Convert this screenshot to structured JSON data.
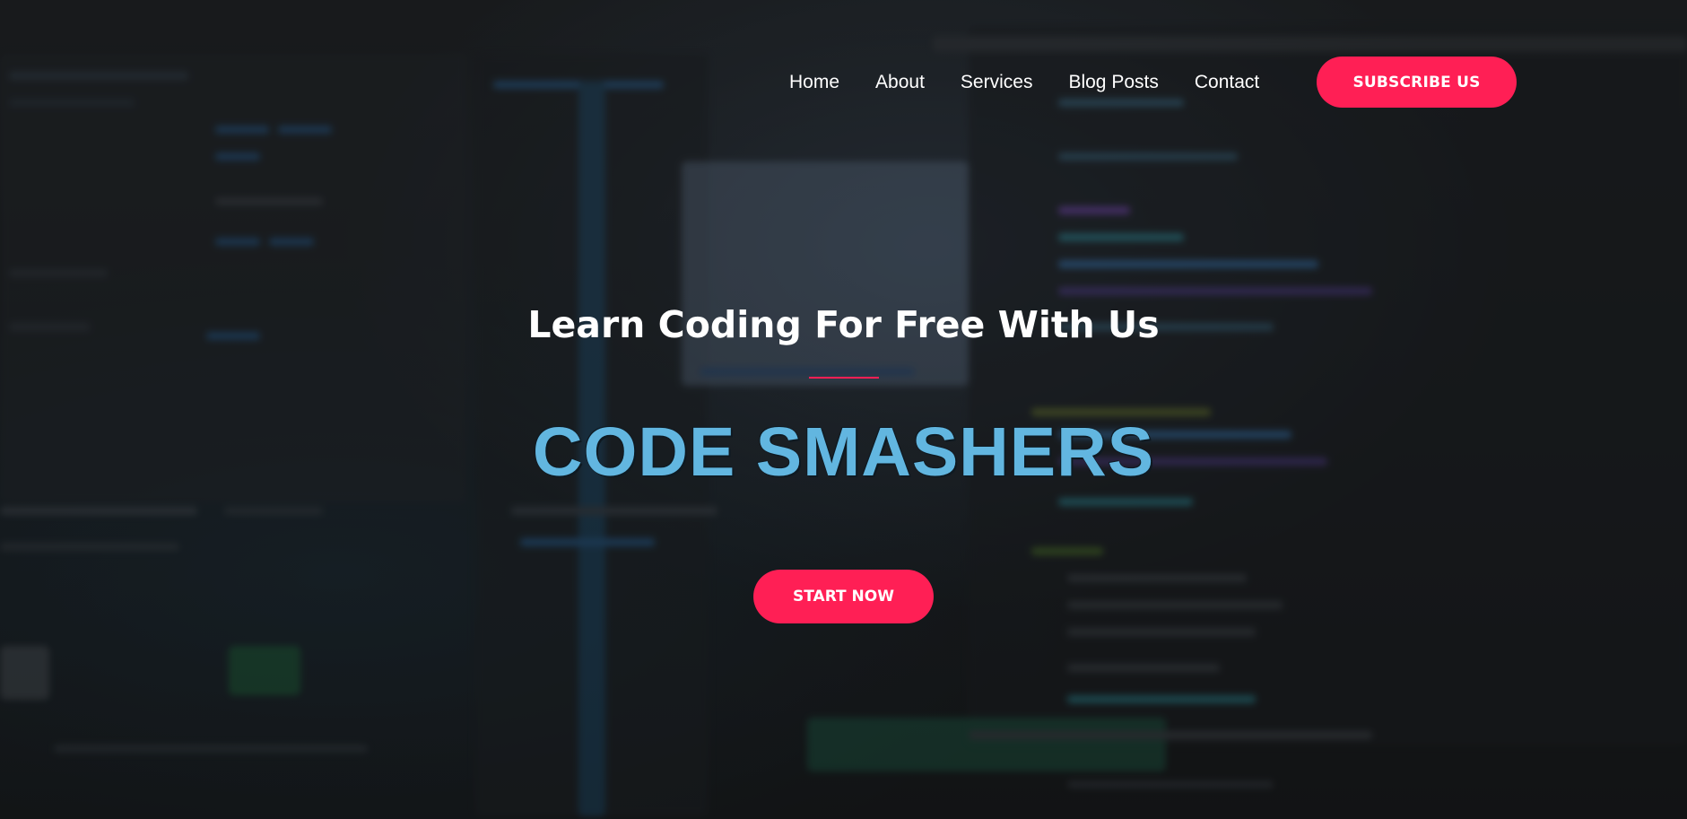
{
  "nav": {
    "items": [
      {
        "label": "Home"
      },
      {
        "label": "About"
      },
      {
        "label": "Services"
      },
      {
        "label": "Blog Posts"
      },
      {
        "label": "Contact"
      }
    ],
    "subscribe_label": "SUBSCRIBE US"
  },
  "hero": {
    "tagline": "Learn Coding For Free With Us",
    "brand": "CODE SMASHERS",
    "cta_label": "START NOW"
  },
  "colors": {
    "accent": "#ff1f55",
    "brand_text": "#62b6e0",
    "background": "#1a1c1f"
  }
}
